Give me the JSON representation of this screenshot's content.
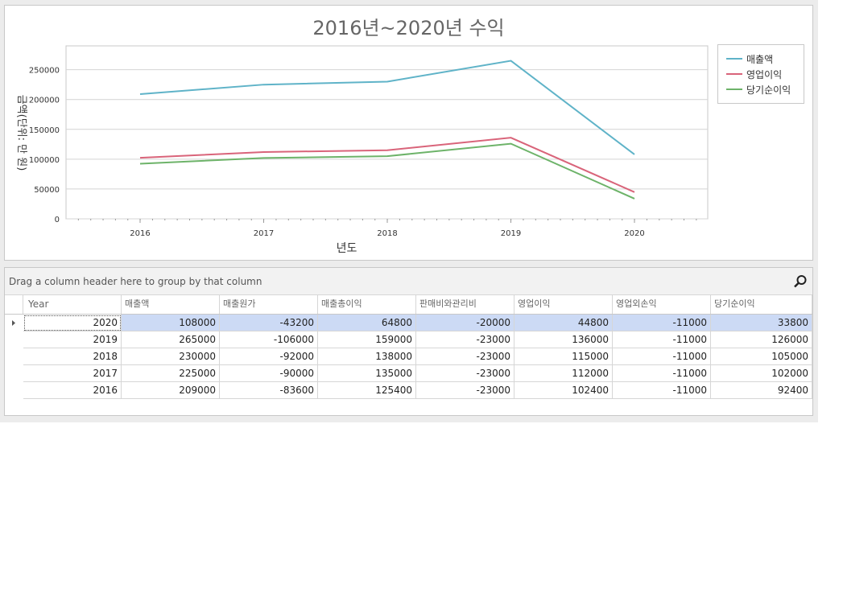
{
  "chart": {
    "title": "2016년~2020년 수익",
    "xlabel": "년도",
    "ylabel": "금액(단위: 만 원)"
  },
  "chart_data": {
    "type": "line",
    "title": "2016년~2020년 수익",
    "xlabel": "년도",
    "ylabel": "금액(단위: 만 원)",
    "categories": [
      "2016",
      "2017",
      "2018",
      "2019",
      "2020"
    ],
    "yticks": [
      "0",
      "50000",
      "100000",
      "150000",
      "200000",
      "250000"
    ],
    "ylim": [
      0,
      290000
    ],
    "grid": true,
    "legend_position": "right",
    "series": [
      {
        "name": "매출액",
        "color": "#5fb3c8",
        "values": [
          209000,
          225000,
          230000,
          265000,
          108000
        ]
      },
      {
        "name": "영업이익",
        "color": "#d9647a",
        "values": [
          102400,
          112000,
          115000,
          136000,
          44800
        ]
      },
      {
        "name": "당기순이익",
        "color": "#6db369",
        "values": [
          92400,
          102000,
          105000,
          126000,
          33800
        ]
      }
    ]
  },
  "grid": {
    "group_hint": "Drag a column header here to group by that column",
    "search_icon": "search-icon",
    "columns": [
      "Year",
      "매출액",
      "매출원가",
      "매출총이익",
      "판매비와관리비",
      "영업이익",
      "영업외손익",
      "당기순이익"
    ],
    "rows": [
      [
        "2020",
        "108000",
        "-43200",
        "64800",
        "-20000",
        "44800",
        "-11000",
        "33800"
      ],
      [
        "2019",
        "265000",
        "-106000",
        "159000",
        "-23000",
        "136000",
        "-11000",
        "126000"
      ],
      [
        "2018",
        "230000",
        "-92000",
        "138000",
        "-23000",
        "115000",
        "-11000",
        "105000"
      ],
      [
        "2017",
        "225000",
        "-90000",
        "135000",
        "-23000",
        "112000",
        "-11000",
        "102000"
      ],
      [
        "2016",
        "209000",
        "-83600",
        "125400",
        "-23000",
        "102400",
        "-11000",
        "92400"
      ]
    ],
    "selected_row": 0
  }
}
